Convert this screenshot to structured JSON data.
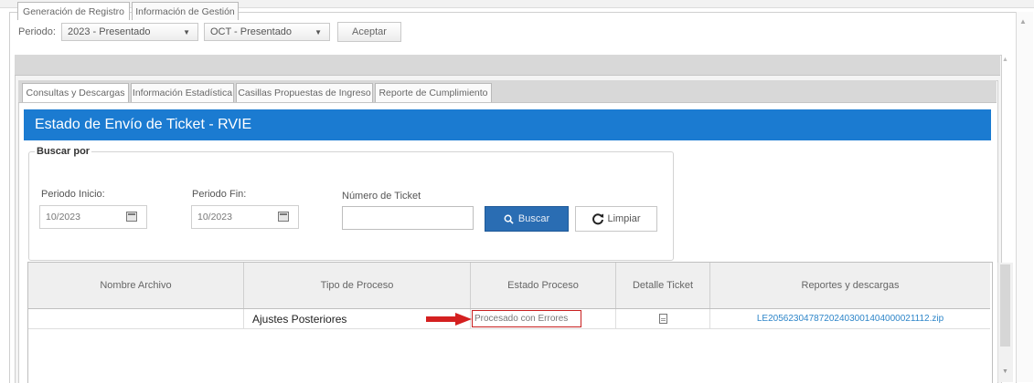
{
  "period": {
    "label": "Periodo:",
    "year_select": "2023 - Presentado",
    "month_select": "OCT - Presentado",
    "accept_button": "Aceptar"
  },
  "tabs_level1": [
    {
      "label": "Generación de Registro"
    },
    {
      "label": "Información de Gestión"
    }
  ],
  "tabs_level2": [
    {
      "label": "Consultas y Descargas"
    },
    {
      "label": "Información Estadística"
    },
    {
      "label": "Casillas Propuestas de Ingreso"
    },
    {
      "label": "Reporte de Cumplimiento"
    }
  ],
  "section_title": "Estado de Envío de Ticket - RVIE",
  "search": {
    "legend": "Buscar por",
    "start_label": "Periodo Inicio:",
    "start_value": "10/2023",
    "end_label": "Periodo Fin:",
    "end_value": "10/2023",
    "ticket_label": "Número de Ticket",
    "ticket_value": "",
    "search_button": "Buscar",
    "clear_button": "Limpiar"
  },
  "table": {
    "headers": [
      "Nombre Archivo",
      "Tipo de Proceso",
      "Estado Proceso",
      "Detalle Ticket",
      "Reportes y descargas"
    ],
    "rows": [
      {
        "file_name": "",
        "process_type": "Ajustes Posteriores",
        "process_status": "Procesado con Errores",
        "ticket_detail_icon": "document-icon",
        "download": "LE20562304787202403001404000021112.zip"
      }
    ]
  },
  "colors": {
    "header_blue": "#1b7bd1",
    "button_blue": "#2a6db3",
    "highlight_red": "#c82020",
    "link_blue": "#2e86c9"
  }
}
